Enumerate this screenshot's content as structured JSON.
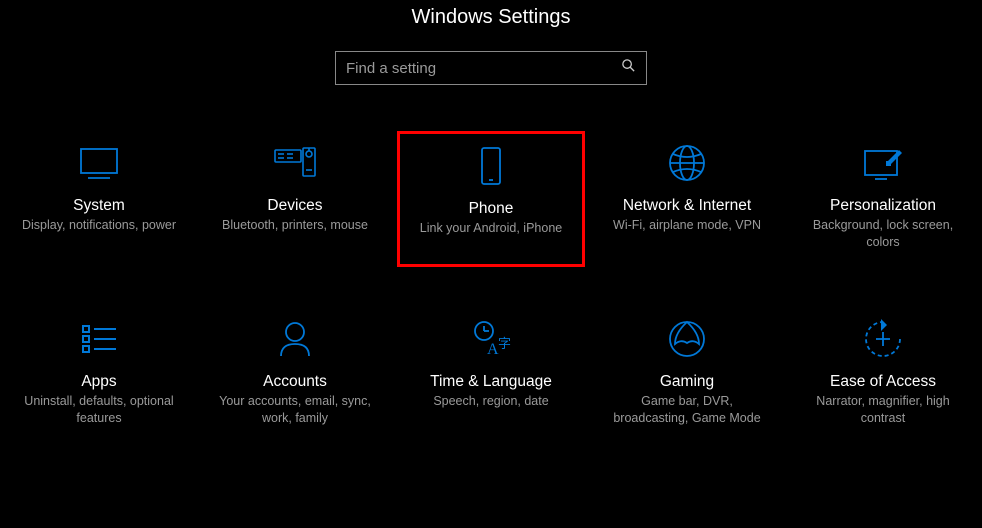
{
  "page": {
    "title": "Windows Settings"
  },
  "search": {
    "placeholder": "Find a setting"
  },
  "tiles": {
    "system": {
      "title": "System",
      "sub": "Display, notifications, power"
    },
    "devices": {
      "title": "Devices",
      "sub": "Bluetooth, printers, mouse"
    },
    "phone": {
      "title": "Phone",
      "sub": "Link your Android, iPhone"
    },
    "network": {
      "title": "Network & Internet",
      "sub": "Wi-Fi, airplane mode, VPN"
    },
    "personal": {
      "title": "Personalization",
      "sub": "Background, lock screen, colors"
    },
    "apps": {
      "title": "Apps",
      "sub": "Uninstall, defaults, optional features"
    },
    "accounts": {
      "title": "Accounts",
      "sub": "Your accounts, email, sync, work, family"
    },
    "time": {
      "title": "Time & Language",
      "sub": "Speech, region, date"
    },
    "gaming": {
      "title": "Gaming",
      "sub": "Game bar, DVR, broadcasting, Game Mode"
    },
    "ease": {
      "title": "Ease of Access",
      "sub": "Narrator, magnifier, high contrast"
    }
  },
  "highlighted_tile": "phone",
  "colors": {
    "accent": "#0078d7",
    "highlight_border": "#ff0000"
  }
}
